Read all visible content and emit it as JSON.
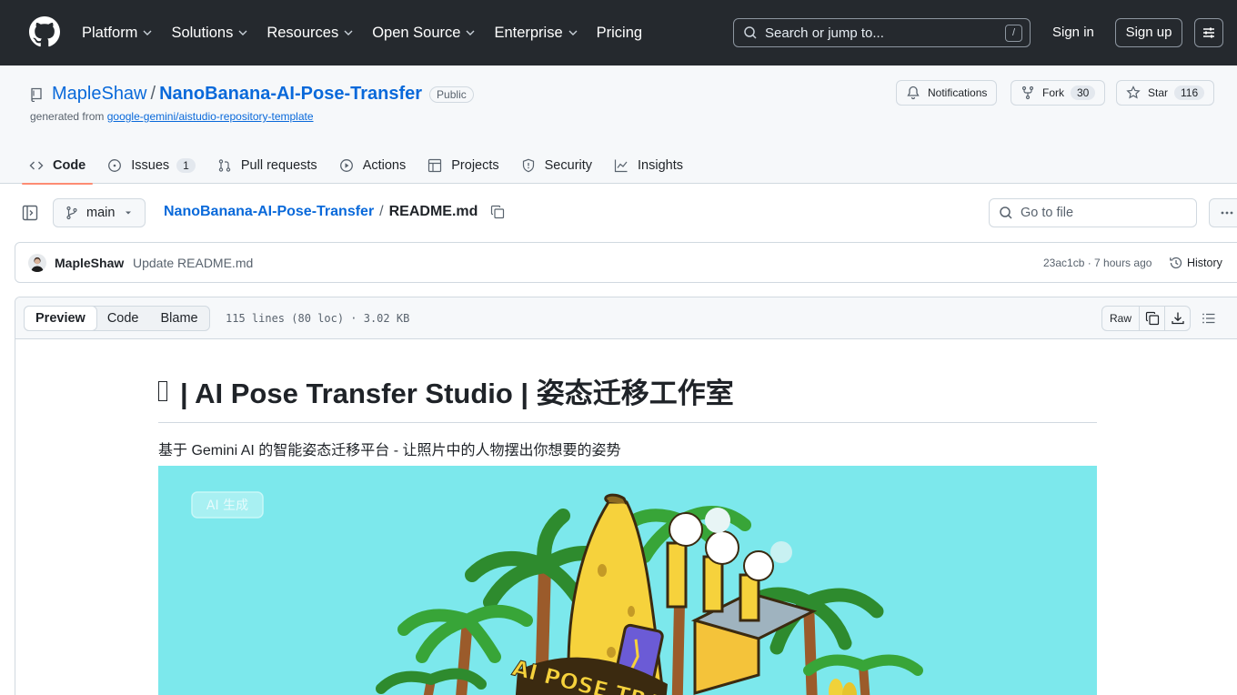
{
  "topnav": {
    "links": [
      "Platform",
      "Solutions",
      "Resources",
      "Open Source",
      "Enterprise",
      "Pricing"
    ],
    "search_placeholder": "Search or jump to...",
    "search_shortcut": "/",
    "signin": "Sign in",
    "signup": "Sign up"
  },
  "repo": {
    "owner": "MapleShaw",
    "separator": "/",
    "name": "NanoBanana-AI-Pose-Transfer",
    "visibility": "Public",
    "generated_from_label": "generated from",
    "generated_from_link": "google-gemini/aistudio-repository-template",
    "notifications_label": "Notifications",
    "fork_label": "Fork",
    "fork_count": "30",
    "star_label": "Star",
    "star_count": "116"
  },
  "tabs": [
    {
      "label": "Code",
      "icon": "code-icon",
      "active": true
    },
    {
      "label": "Issues",
      "icon": "issue-icon",
      "count": "1"
    },
    {
      "label": "Pull requests",
      "icon": "pull-request-icon"
    },
    {
      "label": "Actions",
      "icon": "play-icon"
    },
    {
      "label": "Projects",
      "icon": "table-icon"
    },
    {
      "label": "Security",
      "icon": "shield-icon"
    },
    {
      "label": "Insights",
      "icon": "graph-icon"
    }
  ],
  "filebar": {
    "branch": "main",
    "crumb_repo": "NanoBanana-AI-Pose-Transfer",
    "crumb_sep": "/",
    "file_name": "README.md",
    "goto_placeholder": "Go to file"
  },
  "commit": {
    "author": "MapleShaw",
    "message": "Update README.md",
    "meta": "23ac1cb · 7 hours ago",
    "history_label": "History"
  },
  "fileview": {
    "modes": [
      "Preview",
      "Code",
      "Blame"
    ],
    "active_mode": "Preview",
    "info": "115 lines (80 loc) · 3.02 KB",
    "raw_label": "Raw"
  },
  "readme": {
    "title": "| AI Pose Transfer Studio | 姿态迁移工作室",
    "subtitle": "基于 Gemini AI 的智能姿态迁移平台 - 让照片中的人物摆出你想要的姿势",
    "hero_tag": "AI 生成",
    "hero_sign": "AI POSE TRA"
  },
  "colors": {
    "nav_bg": "#25292e",
    "link": "#0969da",
    "active_tab_underline": "#fd8c73",
    "hero_bg": "#7ce8ec",
    "banana": "#f6d23c"
  }
}
